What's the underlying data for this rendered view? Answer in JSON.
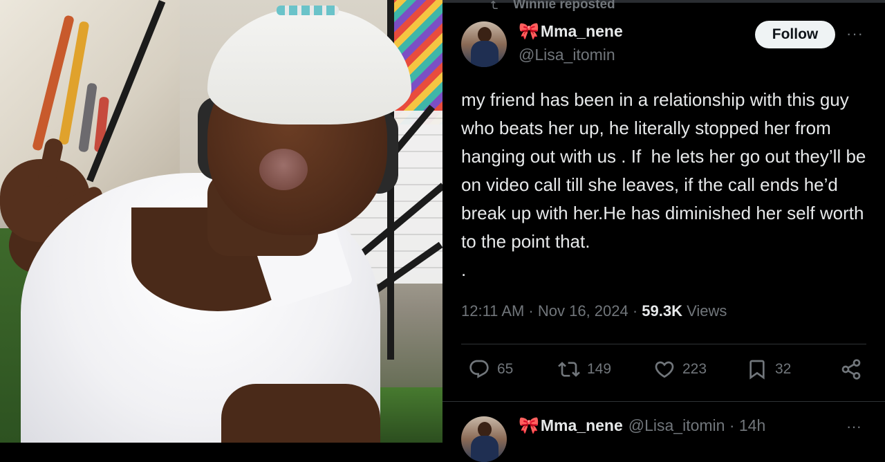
{
  "tweet": {
    "repost_label": "Winnie reposted",
    "author": {
      "display_name": "Mma_nene",
      "handle": "@Lisa_itomin",
      "badge_emoji": "🎀"
    },
    "follow_label": "Follow",
    "more_label": "···",
    "text": "my friend has been in a relationship with this guy who beats her up, he literally stopped her from hanging out with us . If  he lets her go out they’ll be on video call till she leaves, if the call ends he’d break up with her.He has diminished her self worth to the point that.\n.",
    "time": "12:11 AM · Nov 16, 2024 · ",
    "views_count": "59.3K",
    "views_label": "Views",
    "actions": {
      "replies": "65",
      "reposts": "149",
      "likes": "223",
      "bookmarks": "32"
    },
    "icons": {
      "reply": "reply-icon",
      "repost": "repost-icon",
      "like": "heart-icon",
      "bookmark": "bookmark-icon",
      "share": "share-icon"
    }
  },
  "reply_preview": {
    "display_name": "Mma_nene",
    "handle_time": "@Lisa_itomin · 14h",
    "more_label": "···"
  },
  "colors": {
    "background": "#000000",
    "text": "#e7e9ea",
    "muted": "#71767b",
    "follow_bg": "#eff3f4",
    "divider": "#2f3336"
  }
}
